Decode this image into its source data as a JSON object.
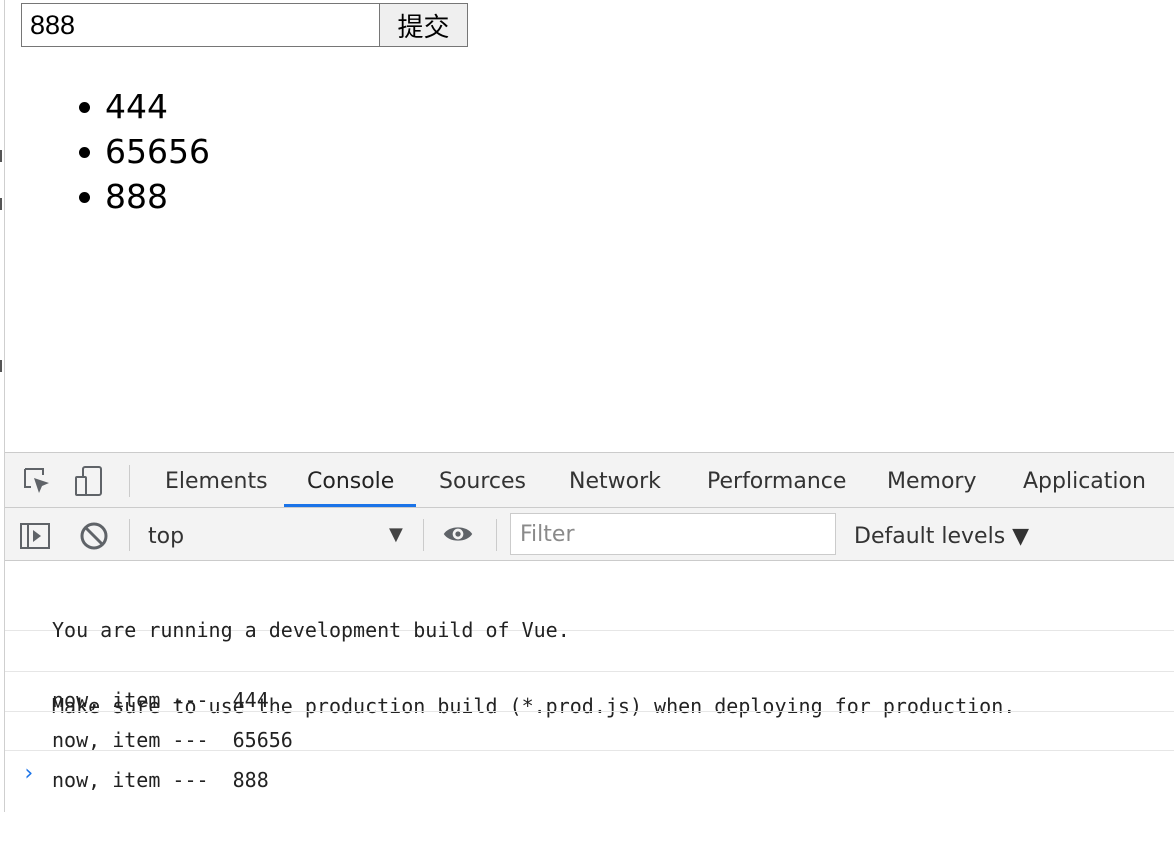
{
  "page": {
    "input_value": "888",
    "submit_label": "提交",
    "items": [
      "444",
      "65656",
      "888"
    ]
  },
  "devtools": {
    "tabs": [
      {
        "label": "Elements"
      },
      {
        "label": "Console",
        "active": true
      },
      {
        "label": "Sources"
      },
      {
        "label": "Network"
      },
      {
        "label": "Performance"
      },
      {
        "label": "Memory"
      },
      {
        "label": "Application"
      }
    ],
    "toolbar": {
      "context": "top",
      "filter_placeholder": "Filter",
      "levels_label": "Default levels ▼"
    },
    "console": {
      "messages": [
        [
          "You are running a development build of Vue.",
          "Make sure to use the production build (*.prod.js) when deploying for production."
        ],
        [
          "now, item ---  444"
        ],
        [
          "now, item ---  65656"
        ],
        [
          "now, item ---  888"
        ]
      ],
      "prompt": "›"
    }
  },
  "colors": {
    "accent": "#1a73e8",
    "toolbar_bg": "#f3f3f3",
    "border": "#cbcbcb"
  }
}
